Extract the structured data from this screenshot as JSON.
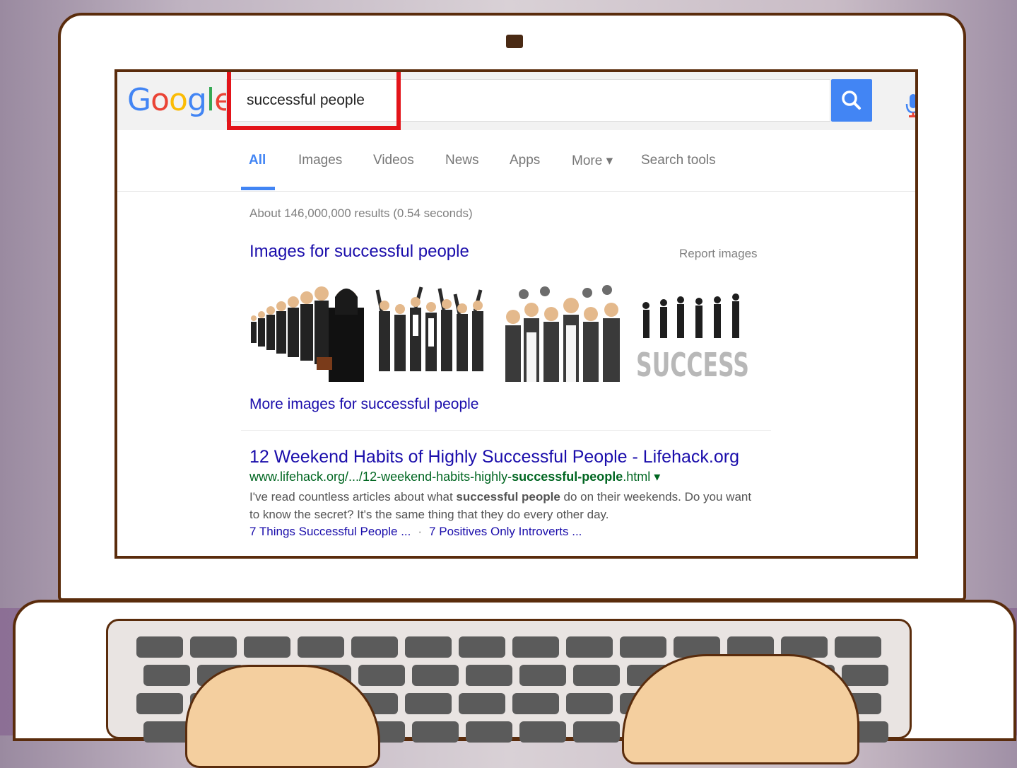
{
  "search": {
    "query": "successful people",
    "logo_letters": [
      {
        "ch": "G",
        "color": "#4285f4"
      },
      {
        "ch": "o",
        "color": "#ea4335"
      },
      {
        "ch": "o",
        "color": "#fbbc05"
      },
      {
        "ch": "g",
        "color": "#4285f4"
      },
      {
        "ch": "l",
        "color": "#34a853"
      },
      {
        "ch": "e",
        "color": "#ea4335"
      }
    ]
  },
  "tabs": [
    {
      "label": "All",
      "active": true
    },
    {
      "label": "Images"
    },
    {
      "label": "Videos"
    },
    {
      "label": "News"
    },
    {
      "label": "Apps"
    },
    {
      "label": "More ▾"
    },
    {
      "label": "Search tools"
    }
  ],
  "results_stats": "About 146,000,000 results (0.54 seconds)",
  "images_block": {
    "title": "Images for successful people",
    "report": "Report images",
    "more": "More images for successful people",
    "success_word": "SUCCESS"
  },
  "result": {
    "title": "12 Weekend Habits of Highly Successful People - Lifehack.org",
    "url_pre": "www.lifehack.org/.../12-weekend-habits-highly-",
    "url_bold": "successful-people",
    "url_post": ".html ▾",
    "snippet_pre": "I've read countless articles about what ",
    "snippet_bold": "successful people",
    "snippet_post": " do on their weekends. Do you want to know the secret? It's the same thing that they do every other day.",
    "link1": "7 Things Successful People ...",
    "link_sep": "·",
    "link2": "7 Positives Only Introverts ..."
  },
  "colors": {
    "accent": "#4285f4",
    "link": "#1a0dab",
    "url": "#006621",
    "highlight": "#e3141a"
  }
}
